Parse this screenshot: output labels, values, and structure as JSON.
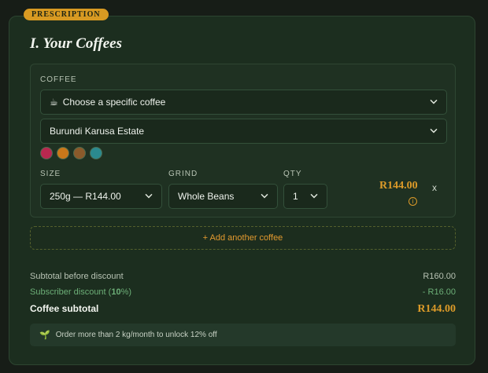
{
  "badge": "PRESCRIPTION",
  "section_title": "I. Your Coffees",
  "item": {
    "coffee_label": "COFFEE",
    "choose_icon": "coffee-cup-icon",
    "choose_text": "Choose a specific coffee",
    "selected_coffee": "Burundi Karusa Estate",
    "swatches": [
      {
        "name": "berry-flavor-icon",
        "color": "#b8284f",
        "glyph": "●"
      },
      {
        "name": "caramel-flavor-icon",
        "color": "#c9781a",
        "glyph": "●"
      },
      {
        "name": "chocolate-flavor-icon",
        "color": "#8a5a2b",
        "glyph": "●"
      },
      {
        "name": "floral-flavor-icon",
        "color": "#2b8a8f",
        "glyph": "●"
      }
    ],
    "size_label": "SIZE",
    "size_value": "250g — R144.00",
    "grind_label": "GRIND",
    "grind_value": "Whole Beans",
    "qty_label": "QTY",
    "qty_value": "1",
    "price": "R144.00",
    "remove_label": "x"
  },
  "add_button": "+ Add another coffee",
  "summary": {
    "subtotal_label": "Subtotal before discount",
    "subtotal_value": "R160.00",
    "discount_label_prefix": "Subscriber discount (",
    "discount_percent": "10",
    "discount_label_suffix": "%)",
    "discount_value": "- R16.00",
    "total_label": "Coffee subtotal",
    "total_value": "R144.00"
  },
  "hint": "Order more than 2 kg/month to unlock 12% off",
  "colors": {
    "accent": "#dd9b29",
    "discount": "#6cae77",
    "card_bg": "#1c2e1f"
  }
}
